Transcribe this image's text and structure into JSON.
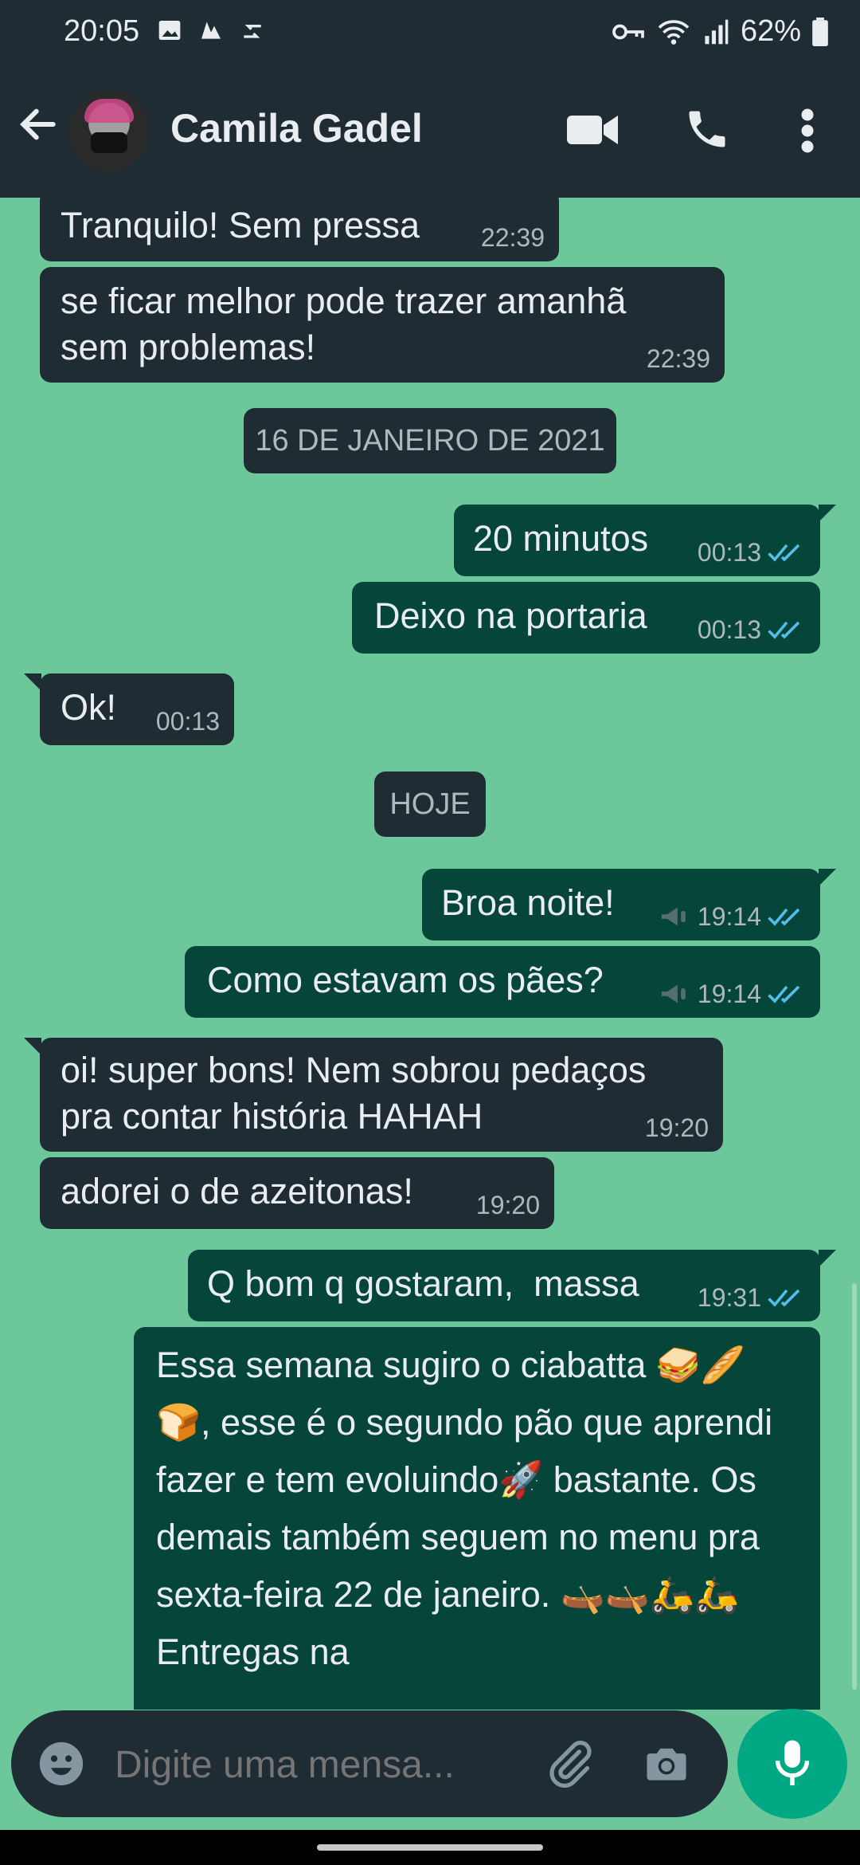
{
  "status_bar": {
    "time": "20:05",
    "battery": "62%"
  },
  "header": {
    "contact_name": "Camila Gadel"
  },
  "messages": [
    {
      "text": "Tranquilo! Sem pressa",
      "time": "22:39"
    },
    {
      "text": "se ficar melhor pode trazer amanhã\nsem problemas!",
      "time": "22:39"
    },
    {
      "date": "16 DE JANEIRO DE 2021"
    },
    {
      "text": "20 minutos",
      "time": "00:13"
    },
    {
      "text": "Deixo na portaria",
      "time": "00:13"
    },
    {
      "text": "Ok!",
      "time": "00:13"
    },
    {
      "date": "HOJE"
    },
    {
      "text": "Broa noite!",
      "time": "19:14"
    },
    {
      "text": "Como estavam os pães?",
      "time": "19:14"
    },
    {
      "text": "oi! super bons! Nem sobrou pedaços\npra contar história HAHAH",
      "time": "19:20"
    },
    {
      "text": "adorei o de azeitonas!",
      "time": "19:20"
    },
    {
      "text": "Q bom q gostaram,  massa",
      "time": "19:31"
    },
    {
      "text": "Essa semana sugiro o ciabatta 🥪🥖🍞, esse é o segundo pão que aprendi fazer e tem evoluindo🚀 bastante. Os demais também seguem no menu pra sexta-feira 22 de janeiro. 🛶🛶🛵🛵Entregas na"
    }
  ],
  "composer": {
    "placeholder": "Digite uma mensa..."
  },
  "colors": {
    "wallpaper": "#6cc89b",
    "incoming": "#1f2c34",
    "outgoing": "#06463a",
    "read_ticks": "#53bdeb",
    "accent": "#00a884"
  }
}
